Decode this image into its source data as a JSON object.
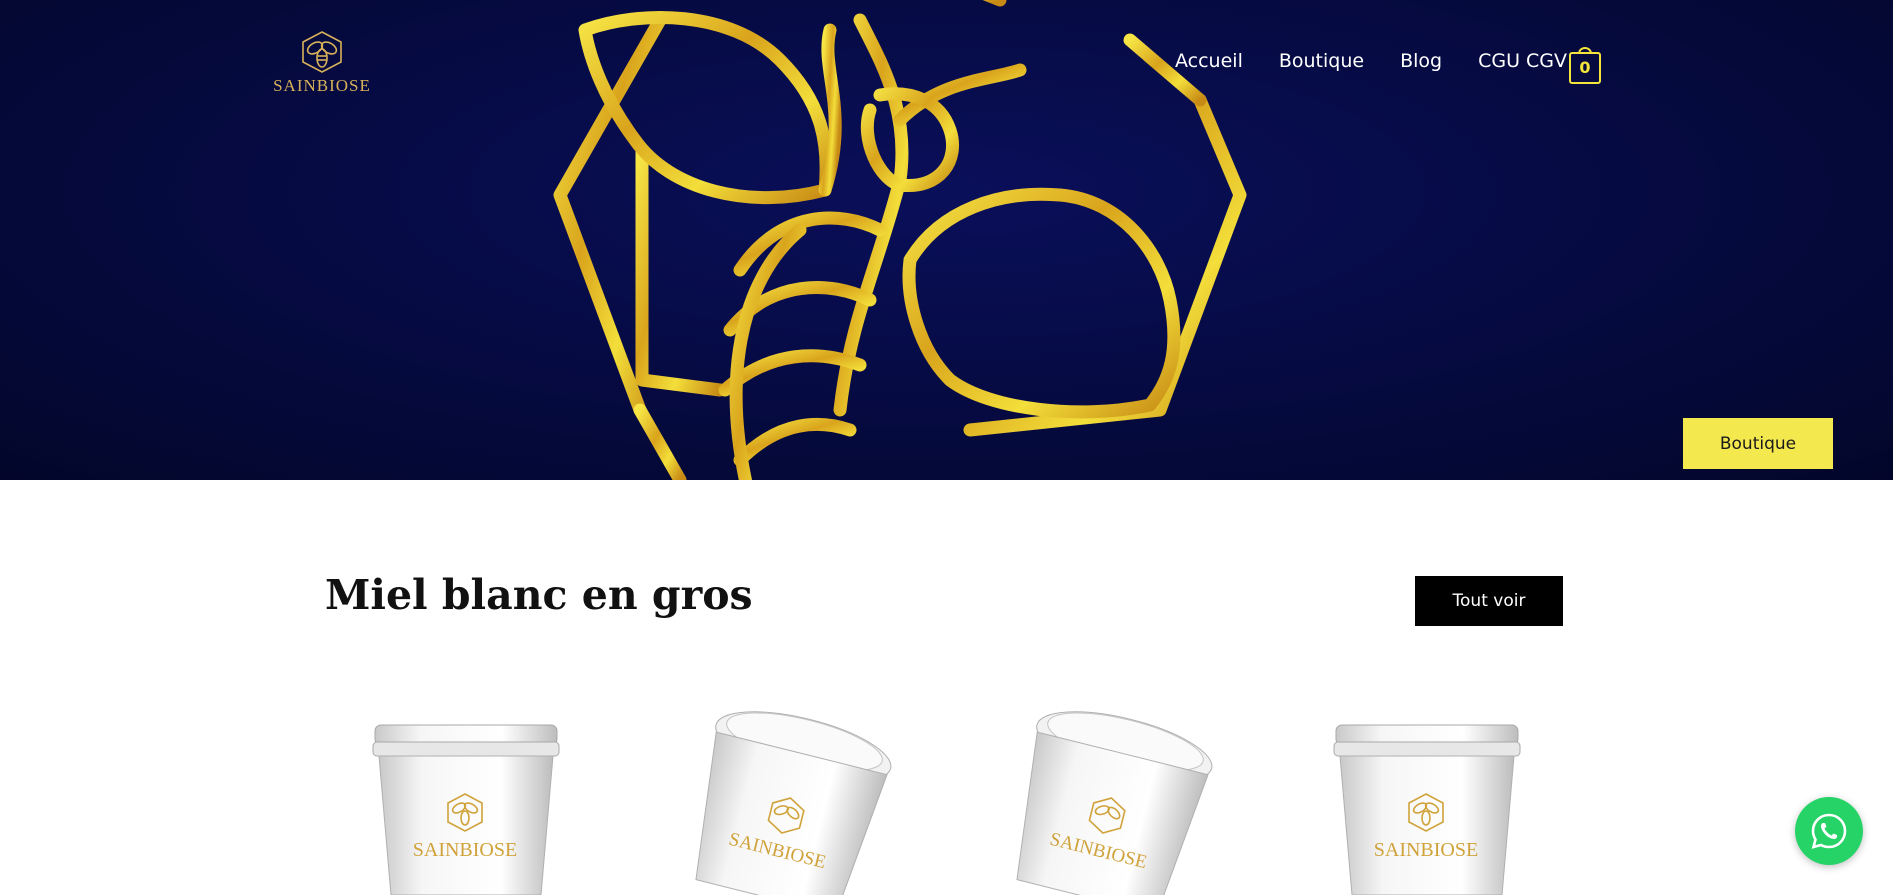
{
  "header": {
    "logo_text": "SAINBIOSE",
    "nav": [
      {
        "label": "Accueil"
      },
      {
        "label": "Boutique"
      },
      {
        "label": "Blog"
      },
      {
        "label": "CGU CGV"
      }
    ],
    "cart_count": "0"
  },
  "hero": {
    "button_label": "Boutique",
    "button_color": "#f3e84e",
    "background_color": "#060b45",
    "emblem_color": "#e6c12a",
    "emblem_icon": "bee-hexagon-emblem"
  },
  "section": {
    "title": "Miel blanc en gros",
    "see_all_label": "Tout voir"
  },
  "products": [
    {
      "image": "honey-bucket-front",
      "label": "SAINBIOSE"
    },
    {
      "image": "honey-bucket-tilted",
      "label": "SAINBIOSE"
    },
    {
      "image": "honey-bucket-tilted",
      "label": "SAINBIOSE"
    },
    {
      "image": "honey-bucket-front",
      "label": "SAINBIOSE"
    }
  ],
  "floating": {
    "whatsapp_icon": "whatsapp-icon",
    "whatsapp_color": "#25d366"
  }
}
